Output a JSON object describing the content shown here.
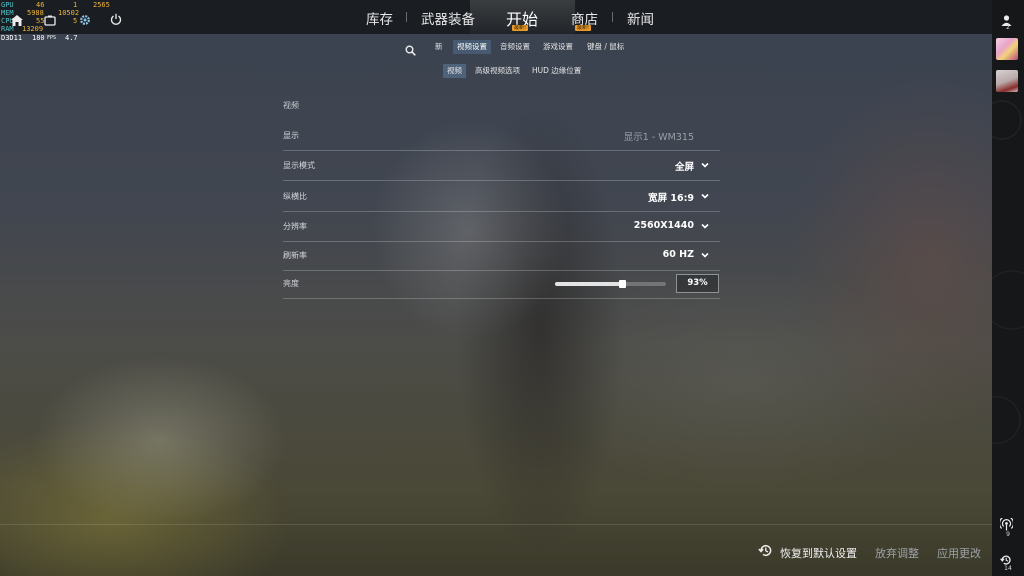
{
  "perf_overlay": {
    "gpu": {
      "label": "GPU",
      "v1": "46",
      "v2": "1",
      "v3": "2565"
    },
    "mem": {
      "label": "MEM",
      "v1": "5988",
      "v2": "10502"
    },
    "cpu": {
      "label": "CPU",
      "v1": "55",
      "v2": "5"
    },
    "ram": {
      "label": "RAM",
      "v1": "13209"
    },
    "d3d": {
      "label": "D3D11",
      "fps": "180",
      "fps_unit": "FPS",
      "ms": "4.7"
    }
  },
  "top_nav": {
    "items": [
      {
        "label": "库存"
      },
      {
        "label": "武器装备"
      },
      {
        "label": "开始",
        "badge": "最新!"
      },
      {
        "label": "商店",
        "badge": "最新!"
      },
      {
        "label": "新闻"
      }
    ]
  },
  "sub_nav": {
    "items": [
      {
        "label": "新"
      },
      {
        "label": "视频设置"
      },
      {
        "label": "音频设置"
      },
      {
        "label": "游戏设置"
      },
      {
        "label": "键盘 / 鼠标"
      }
    ]
  },
  "tabs": {
    "items": [
      {
        "label": "视频"
      },
      {
        "label": "高级视频选项"
      },
      {
        "label": "HUD 边缘位置"
      }
    ]
  },
  "settings": {
    "section_title": "视频",
    "rows": [
      {
        "label": "显示",
        "value": "显示1 - WM315"
      },
      {
        "label": "显示模式",
        "value": "全屏"
      },
      {
        "label": "纵横比",
        "value": "宽屏 16:9"
      },
      {
        "label": "分辨率",
        "value": "2560X1440"
      },
      {
        "label": "刷新率",
        "value": "60 HZ"
      },
      {
        "label": "亮度",
        "value": "93%",
        "level": 0.6
      }
    ]
  },
  "bottom_bar": {
    "reset_label": "恢复到默认设置",
    "discard_label": "放弃调整",
    "apply_label": "应用更改"
  },
  "sidebar": {
    "friends_count": "2",
    "signal_count": "9",
    "history_count": "14"
  }
}
